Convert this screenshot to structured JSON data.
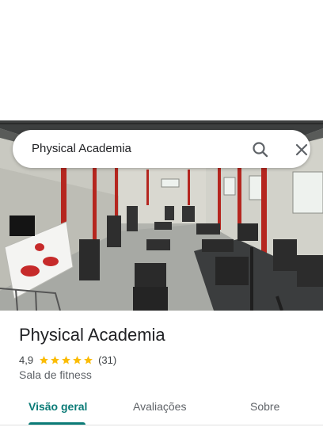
{
  "search": {
    "query": "Physical Academia"
  },
  "place": {
    "name": "Physical Academia",
    "rating": "4,9",
    "stars": 5,
    "review_count": "(31)",
    "category": "Sala de fitness"
  },
  "tabs": [
    {
      "label": "Visão geral",
      "active": true
    },
    {
      "label": "Avaliações",
      "active": false
    },
    {
      "label": "Sobre",
      "active": false
    }
  ],
  "colors": {
    "accent": "#0b7b77",
    "star": "#fbbc04"
  }
}
